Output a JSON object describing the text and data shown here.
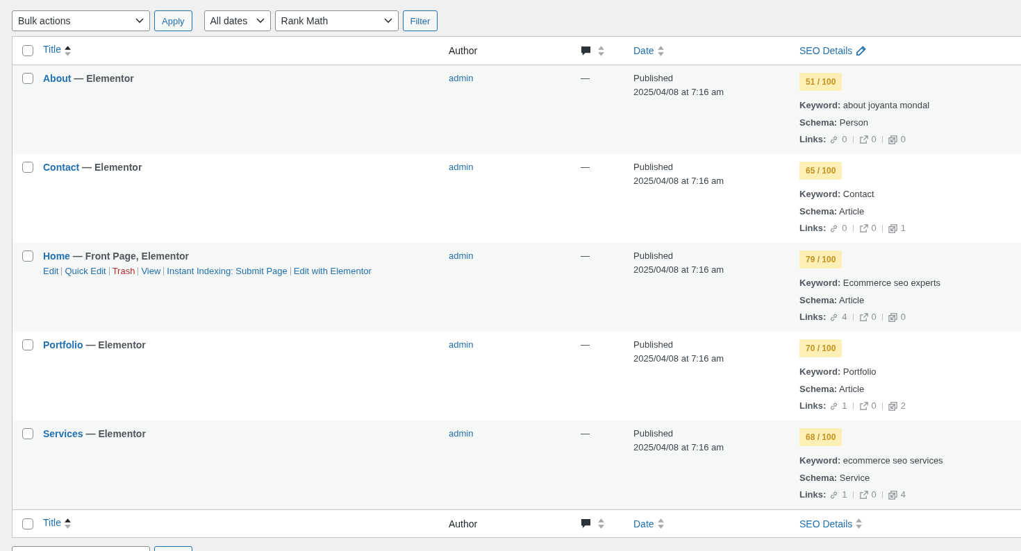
{
  "top_nav": {
    "bulk_action": "Bulk actions",
    "apply": "Apply",
    "date_filter": "All dates",
    "seo_filter": "Rank Math",
    "filter": "Filter"
  },
  "header": {
    "select_all_checked": false,
    "columns": [
      {
        "label": "Title",
        "kind": "sortable",
        "sorted": true
      },
      {
        "label": "Author",
        "kind": "plain"
      },
      {
        "kind": "comments",
        "sorted": false
      },
      {
        "label": "Date",
        "kind": "sortable",
        "sorted": false
      },
      {
        "label": "SEO Details",
        "kind": "editable"
      }
    ]
  },
  "rows": [
    {
      "checked": false,
      "title": "About",
      "state": "— Elementor",
      "actions": [],
      "author": "admin",
      "comments": "—",
      "status": "Published",
      "date": "2025/04/08 at 7:16 am",
      "score": "51 / 100",
      "keyword_label": "Keyword:",
      "keyword": "about joyanta mondal",
      "schema_label": "Schema:",
      "schema": "Person",
      "links_label": "Links:",
      "links": [
        "0",
        "0",
        "0"
      ]
    },
    {
      "checked": false,
      "title": "Contact",
      "state": "— Elementor",
      "actions": [],
      "author": "admin",
      "comments": "—",
      "status": "Published",
      "date": "2025/04/08 at 7:16 am",
      "score": "65 / 100",
      "keyword_label": "Keyword:",
      "keyword": "Contact",
      "schema_label": "Schema:",
      "schema": "Article",
      "links_label": "Links:",
      "links": [
        "0",
        "0",
        "1"
      ]
    },
    {
      "checked": false,
      "title": "Home",
      "state": "— Front Page, Elementor",
      "actions": [
        {
          "label": "Edit",
          "kind": "link"
        },
        {
          "label": "Quick Edit",
          "kind": "link"
        },
        {
          "label": "Trash",
          "kind": "delete"
        },
        {
          "label": "View",
          "kind": "link"
        },
        {
          "label": "Instant Indexing: Submit Page",
          "kind": "link"
        },
        {
          "label": "Edit with Elementor",
          "kind": "link"
        }
      ],
      "author": "admin",
      "comments": "—",
      "status": "Published",
      "date": "2025/04/08 at 7:16 am",
      "score": "79 / 100",
      "keyword_label": "Keyword:",
      "keyword": "Ecommerce seo experts",
      "schema_label": "Schema:",
      "schema": "Article",
      "links_label": "Links:",
      "links": [
        "4",
        "0",
        "0"
      ]
    },
    {
      "checked": false,
      "title": "Portfolio",
      "state": "— Elementor",
      "actions": [],
      "author": "admin",
      "comments": "—",
      "status": "Published",
      "date": "2025/04/08 at 7:16 am",
      "score": "70 / 100",
      "keyword_label": "Keyword:",
      "keyword": "Portfolio",
      "schema_label": "Schema:",
      "schema": "Article",
      "links_label": "Links:",
      "links": [
        "1",
        "0",
        "2"
      ]
    },
    {
      "checked": false,
      "title": "Services",
      "state": "— Elementor",
      "actions": [],
      "author": "admin",
      "comments": "—",
      "status": "Published",
      "date": "2025/04/08 at 7:16 am",
      "score": "68 / 100",
      "keyword_label": "Keyword:",
      "keyword": "ecommerce seo services",
      "schema_label": "Schema:",
      "schema": "Service",
      "links_label": "Links:",
      "links": [
        "1",
        "0",
        "4"
      ]
    }
  ],
  "footer": {
    "select_all_checked": false,
    "columns": [
      {
        "label": "Title",
        "kind": "sortable",
        "sorted": true
      },
      {
        "label": "Author",
        "kind": "plain"
      },
      {
        "kind": "comments",
        "sorted": false
      },
      {
        "label": "Date",
        "kind": "sortable",
        "sorted": false
      },
      {
        "label": "SEO Details",
        "kind": "sortable",
        "sorted": false
      }
    ]
  }
}
